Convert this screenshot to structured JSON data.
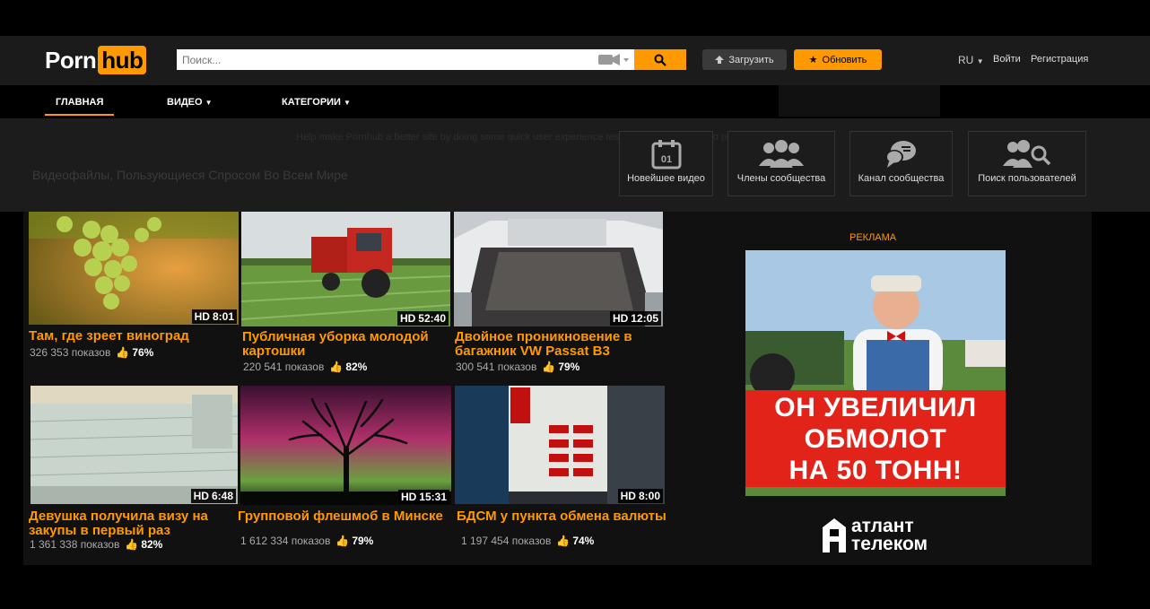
{
  "header": {
    "logo_part1": "Porn",
    "logo_part2": "hub",
    "search_placeholder": "Поиск...",
    "upload_label": "Загрузить",
    "premium_label": "Обновить",
    "lang": "RU",
    "login": "Войти",
    "register": "Регистрация"
  },
  "nav": {
    "items": [
      "ГЛАВНАЯ",
      "ВИДЕО",
      "КАТЕГОРИИ"
    ],
    "active": "ГЛАВНАЯ"
  },
  "dropdown": {
    "ghost_text": "Help make Pornhub a better site by doing some quick user experience tests about our new video player.",
    "ghost_heading": "Видеофайлы, Пользующиеся Спросом Во Всем Мире",
    "tiles": [
      {
        "label": "Новейшее видео",
        "icon": "calendar-icon",
        "icon_text": "01"
      },
      {
        "label": "Члены сообщества",
        "icon": "community-icon"
      },
      {
        "label": "Канал сообщества",
        "icon": "feed-icon"
      },
      {
        "label": "Поиск пользователей",
        "icon": "user-search-icon"
      }
    ]
  },
  "videos": [
    {
      "title": "Там, где зреет виноград",
      "hd": "HD",
      "duration": "8:01",
      "views": "326 353 показов",
      "rating": "76%"
    },
    {
      "title": "Публичная уборка молодой картошки",
      "hd": "HD",
      "duration": "52:40",
      "views": "220 541 показов",
      "rating": "82%"
    },
    {
      "title": "Двойное проникновение в багажник VW Passat B3",
      "hd": "HD",
      "duration": "12:05",
      "views": "300 541 показов",
      "rating": "79%"
    },
    {
      "title": "Девушка получила визу на закупы в первый раз",
      "hd": "HD",
      "duration": "6:48",
      "views": "1 361 338 показов",
      "rating": "82%"
    },
    {
      "title": "Групповой флешмоб в Минске",
      "hd": "HD",
      "duration": "15:31",
      "views": "1 612 334 показов",
      "rating": "79%"
    },
    {
      "title": "БДСМ у пункта обмена валюты",
      "hd": "HD",
      "duration": "8:00",
      "views": "1 197 454 показов",
      "rating": "74%"
    }
  ],
  "ad": {
    "label": "РЕКЛАМА",
    "line1": "ОН УВЕЛИЧИЛ",
    "line2": "ОБМОЛОТ",
    "line3": "НА 50 ТОНН!",
    "brand1": "атлант",
    "brand2": "телеком"
  },
  "colors": {
    "accent": "#ff9900",
    "background": "#000000",
    "panel": "#1b1b1b",
    "ad_red": "#e2231a"
  }
}
